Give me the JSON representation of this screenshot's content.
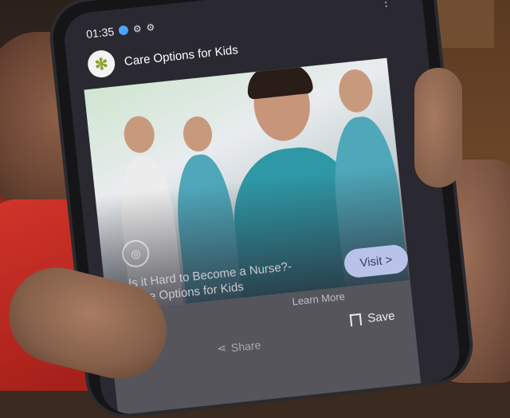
{
  "status_bar": {
    "time": "01:35",
    "icons": [
      "location-icon",
      "notification-icon",
      "notification-icon"
    ],
    "overflow_icon": "more-vert-icon"
  },
  "app": {
    "title": "Care Options for Kids",
    "logo_icon": "leaf-logo-icon"
  },
  "ad": {
    "image_subject": "nurses",
    "title": "Is it Hard to Become a Nurse?- Care Options for Kids",
    "visit_label": "Visit >",
    "learn_more_label": "Learn More",
    "save_label": "Save",
    "share_label": "Share",
    "accent_color": "#b9c3ea"
  }
}
